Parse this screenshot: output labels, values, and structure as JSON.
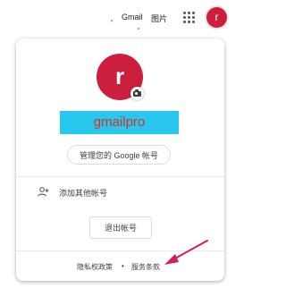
{
  "topbar": {
    "gmail_label": "Gmail",
    "images_label": "图片",
    "avatar_letter": "r"
  },
  "account_card": {
    "avatar_letter": "r",
    "display_name": "gmailpro",
    "manage_account_label": "管理您的 Google 帐号",
    "add_account_label": "添加其他帐号",
    "sign_out_label": "退出帐号"
  },
  "footer": {
    "privacy_label": "隐私权政策",
    "separator": "•",
    "terms_label": "服务条款"
  },
  "colors": {
    "avatar": "#cc1f3e",
    "name_highlight_bg": "#29c6ee",
    "name_highlight_text": "#d93025",
    "annotation_arrow": "#d81b60"
  },
  "icons": {
    "apps": "apps-grid-icon",
    "camera": "camera-icon",
    "add_user": "person-add-icon"
  }
}
